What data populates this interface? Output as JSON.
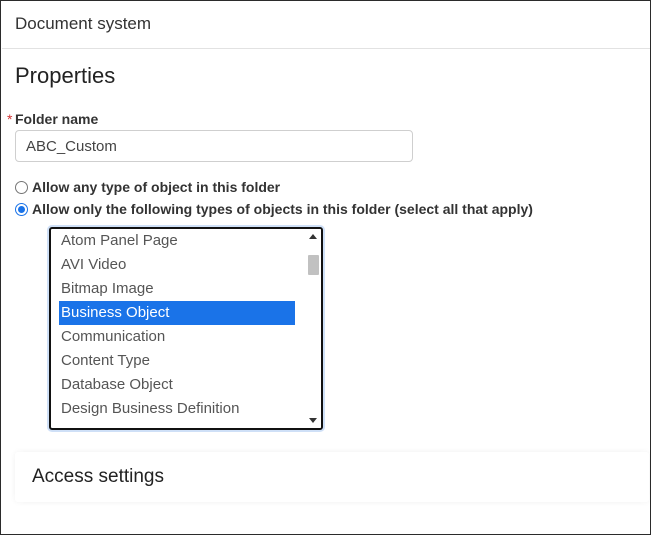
{
  "header": {
    "title": "Document system"
  },
  "properties": {
    "title": "Properties",
    "folder_name": {
      "required_mark": "*",
      "label": "Folder name",
      "value": "ABC_Custom"
    },
    "options": [
      {
        "label": "Allow any type of object in this folder",
        "checked": false
      },
      {
        "label": "Allow only the following types of objects in this folder (select all that apply)",
        "checked": true
      }
    ],
    "object_types": [
      {
        "label": "Atom Panel Page",
        "selected": false
      },
      {
        "label": "AVI Video",
        "selected": false
      },
      {
        "label": "Bitmap Image",
        "selected": false
      },
      {
        "label": "Business Object",
        "selected": true
      },
      {
        "label": "Communication",
        "selected": false
      },
      {
        "label": "Content Type",
        "selected": false
      },
      {
        "label": "Database Object",
        "selected": false
      },
      {
        "label": "Design Business Definition",
        "selected": false
      }
    ]
  },
  "access": {
    "title": "Access settings"
  },
  "colors": {
    "accent": "#1a73e8",
    "required": "#d03030"
  }
}
